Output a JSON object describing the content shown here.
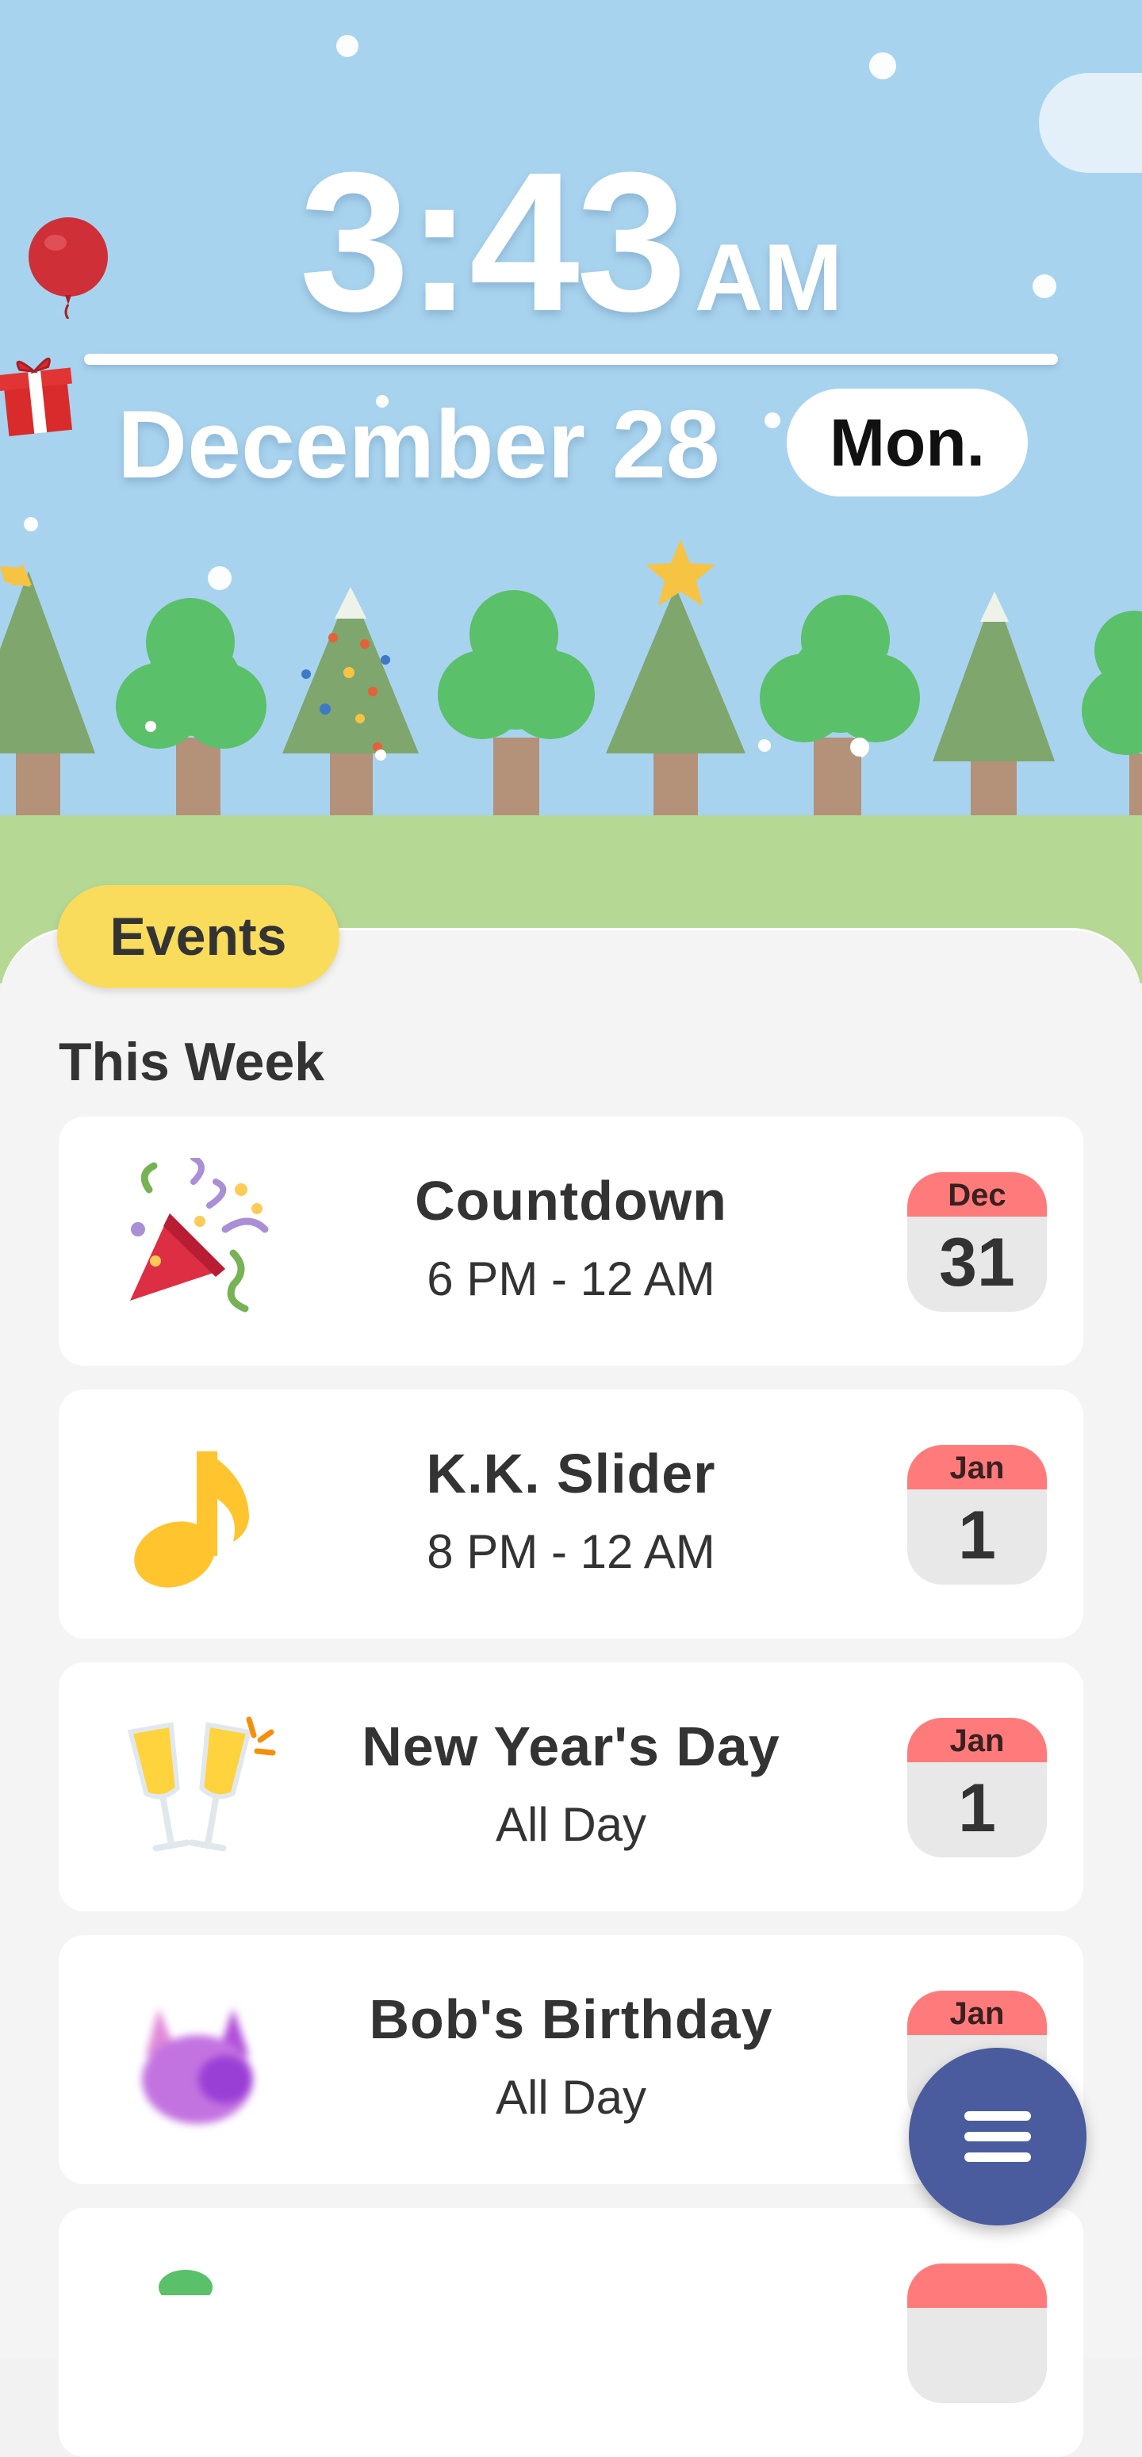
{
  "clock": {
    "time": "3:43",
    "ampm": "AM",
    "date": "December 28",
    "weekday": "Mon."
  },
  "events_label": "Events",
  "section": "This Week",
  "events": [
    {
      "name": "Countdown",
      "time": "6 PM - 12 AM",
      "month": "Dec",
      "day": "31",
      "icon": "party-popper-icon"
    },
    {
      "name": "K.K. Slider",
      "time": "8 PM - 12 AM",
      "month": "Jan",
      "day": "1",
      "icon": "music-note-icon"
    },
    {
      "name": "New Year's Day",
      "time": "All Day",
      "month": "Jan",
      "day": "1",
      "icon": "champagne-glasses-icon"
    },
    {
      "name": "Bob's Birthday",
      "time": "All Day",
      "month": "Jan",
      "day": "",
      "icon": "villager-avatar-icon"
    }
  ],
  "colors": {
    "sky": "#a8d3ee",
    "grass": "#b5d995",
    "badge": "#f9dc5c",
    "calendar_header": "#ff7b7b",
    "fab": "#4a5c9e"
  }
}
